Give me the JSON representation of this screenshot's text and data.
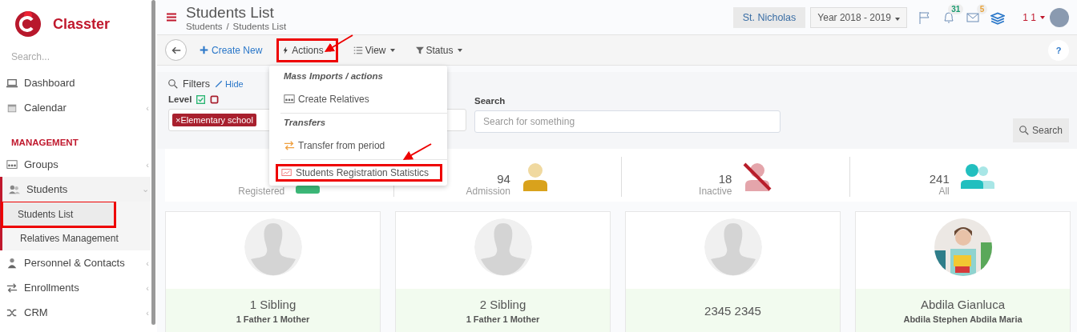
{
  "brand": {
    "name": "Classter"
  },
  "sidebar": {
    "search_placeholder": "Search...",
    "items": [
      {
        "kind": "item",
        "label": "Dashboard"
      },
      {
        "kind": "item",
        "label": "Calendar",
        "chevron": "‹"
      },
      {
        "kind": "section",
        "label": "MANAGEMENT"
      },
      {
        "kind": "item",
        "label": "Groups",
        "chevron": "‹"
      },
      {
        "kind": "item",
        "label": "Students",
        "chevron": "⌄",
        "expanded": true,
        "children": [
          {
            "label": "Students List",
            "selected": true,
            "highlighted": true
          },
          {
            "label": "Relatives Management",
            "selected": false,
            "highlighted": false
          }
        ]
      },
      {
        "kind": "item",
        "label": "Personnel & Contacts",
        "chevron": "‹"
      },
      {
        "kind": "item",
        "label": "Enrollments",
        "chevron": "‹"
      },
      {
        "kind": "item",
        "label": "CRM",
        "chevron": "‹"
      }
    ]
  },
  "header": {
    "title": "Students List",
    "breadcrumb": [
      "Students",
      "Students List"
    ],
    "breadcrumb_separator": "/",
    "school": "St. Nicholas",
    "year": "Year 2018 - 2019",
    "notifications": "31",
    "messages": "5",
    "user": "1 1"
  },
  "toolbar": {
    "create": "Create New",
    "menus": [
      {
        "label": "Actions",
        "highlighted": true
      },
      {
        "label": "View",
        "highlighted": false
      },
      {
        "label": "Status",
        "highlighted": false
      }
    ],
    "help": "?"
  },
  "actions_menu": [
    {
      "kind": "header",
      "label": "Mass Imports / actions"
    },
    {
      "kind": "item",
      "label": "Create Relatives",
      "highlighted": false
    },
    {
      "kind": "header",
      "label": "Transfers"
    },
    {
      "kind": "item",
      "label": "Transfer from period",
      "highlighted": false
    },
    {
      "kind": "item",
      "label": "Students Registration Statistics",
      "highlighted": true
    }
  ],
  "filters": {
    "title": "Filters",
    "hide": "Hide",
    "level_label": "Level",
    "level_tags": [
      "×Elementary school"
    ],
    "search_label": "Search",
    "search_placeholder": "Search for something",
    "search_button": "Search"
  },
  "stats": [
    {
      "label": "Registered",
      "kind": "registered"
    },
    {
      "count": "94",
      "label": "Admission",
      "kind": "admission"
    },
    {
      "count": "18",
      "label": "Inactive",
      "kind": "inactive"
    },
    {
      "count": "241",
      "label": "All",
      "kind": "all"
    }
  ],
  "students": [
    {
      "name": "1 Sibling",
      "relatives": "1 Father 1 Mother",
      "kind": "placeholder"
    },
    {
      "name": "2 Sibling",
      "relatives": "1 Father 1 Mother",
      "kind": "placeholder"
    },
    {
      "name": "2345 2345",
      "kind": "placeholder"
    },
    {
      "name": "Abdila Gianluca",
      "relatives": "Abdila Stephen Abdila Maria",
      "kind": "picture"
    }
  ]
}
